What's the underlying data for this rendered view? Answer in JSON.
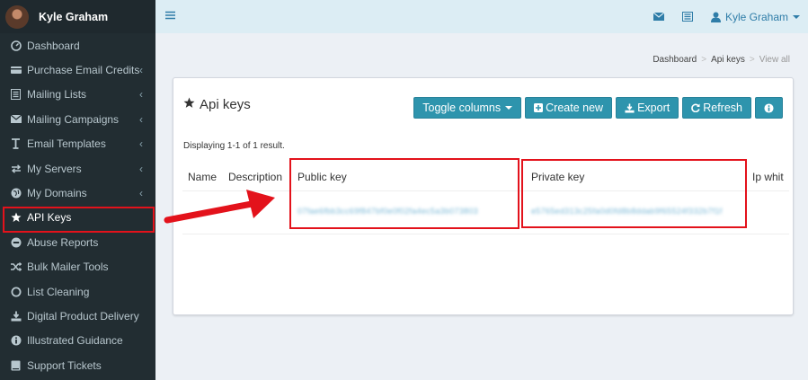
{
  "user": {
    "name": "Kyle Graham"
  },
  "sidebar": {
    "items": [
      {
        "label": "Dashboard",
        "icon": "dashboard-icon",
        "has_submenu": false
      },
      {
        "label": "Purchase Email Credits",
        "icon": "credit-card-icon",
        "has_submenu": true
      },
      {
        "label": "Mailing Lists",
        "icon": "list-icon",
        "has_submenu": true
      },
      {
        "label": "Mailing Campaigns",
        "icon": "envelope-icon",
        "has_submenu": true
      },
      {
        "label": "Email Templates",
        "icon": "text-icon",
        "has_submenu": true
      },
      {
        "label": "My Servers",
        "icon": "exchange-icon",
        "has_submenu": true
      },
      {
        "label": "My Domains",
        "icon": "globe-icon",
        "has_submenu": true
      },
      {
        "label": "API Keys",
        "icon": "star-icon",
        "has_submenu": false,
        "active": true
      },
      {
        "label": "Abuse Reports",
        "icon": "minus-circle-icon",
        "has_submenu": false
      },
      {
        "label": "Bulk Mailer Tools",
        "icon": "random-icon",
        "has_submenu": false
      },
      {
        "label": "List Cleaning",
        "icon": "circle-icon",
        "has_submenu": false
      },
      {
        "label": "Digital Product Delivery",
        "icon": "download-icon",
        "has_submenu": false
      },
      {
        "label": "Illustrated Guidance",
        "icon": "info-circle-icon",
        "has_submenu": false
      },
      {
        "label": "Support Tickets",
        "icon": "book-icon",
        "has_submenu": false
      }
    ]
  },
  "breadcrumb": {
    "items": [
      "Dashboard",
      "Api keys",
      "View all"
    ]
  },
  "box": {
    "title": "Api keys",
    "buttons": {
      "toggle_columns": "Toggle columns",
      "create_new": "Create new",
      "export": "Export",
      "refresh": "Refresh"
    },
    "summary": "Displaying 1-1 of 1 result."
  },
  "table": {
    "columns": [
      "Name",
      "Description",
      "Public key",
      "Private key",
      "Ip whit"
    ],
    "rows": [
      {
        "name": "",
        "description": "",
        "public_key": "07fae6fbb3cc69f847bf0e0f02fa4ec5a3b073803",
        "private_key": "e5765ed313c25fa0d0fd8b8ddab9f65524f332b7f1f",
        "ip": ""
      }
    ]
  },
  "colors": {
    "sidebar_bg": "#222d32",
    "accent": "#2e94ad",
    "highlight": "#e3121b",
    "topbar_bg": "#dcedf4"
  }
}
